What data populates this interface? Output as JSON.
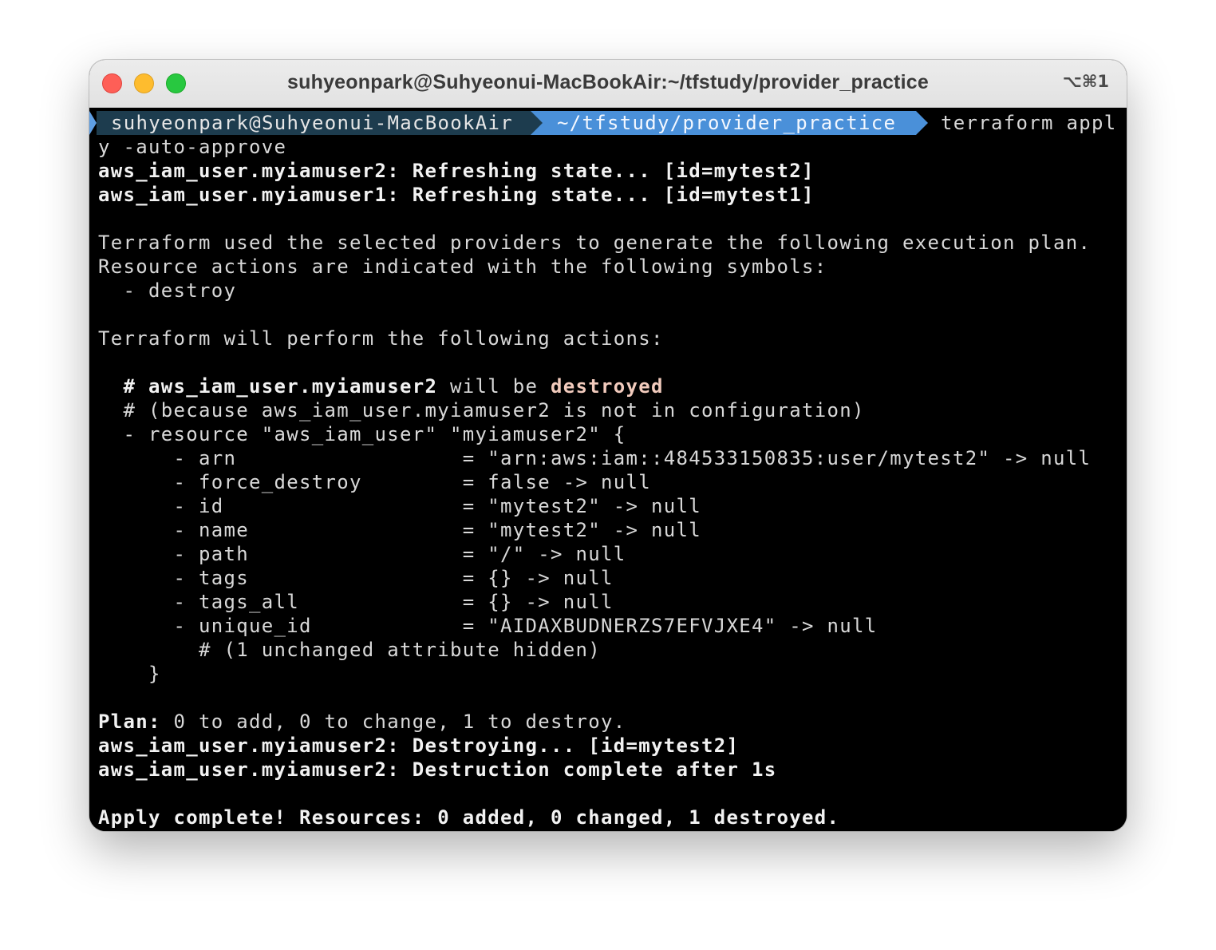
{
  "window": {
    "title": "suhyeonpark@Suhyeonui-MacBookAir:~/tfstudy/provider_practice",
    "shortcut": "⌥⌘1"
  },
  "prompt": {
    "user_host": "suhyeonpark@Suhyeonui-MacBookAir",
    "path": "~/tfstudy/provider_practice",
    "command_part1": "terraform appl",
    "command_part2": "y -auto-approve"
  },
  "output": {
    "refresh1": "aws_iam_user.myiamuser2: Refreshing state... [id=mytest2]",
    "refresh2": "aws_iam_user.myiamuser1: Refreshing state... [id=mytest1]",
    "plan_intro1": "Terraform used the selected providers to generate the following execution plan.",
    "plan_intro2": "Resource actions are indicated with the following symbols:",
    "symbol_destroy": "  - destroy",
    "perform": "Terraform will perform the following actions:",
    "resource_comment_hash": "  # ",
    "resource_comment_name": "aws_iam_user.myiamuser2",
    "resource_comment_mid": " will be ",
    "resource_comment_action": "destroyed",
    "because": "  # (because aws_iam_user.myiamuser2 is not in configuration)",
    "resource_open": "  - resource \"aws_iam_user\" \"myiamuser2\" {",
    "attributes": [
      "      - arn                  = \"arn:aws:iam::484533150835:user/mytest2\" -> null",
      "      - force_destroy        = false -> null",
      "      - id                   = \"mytest2\" -> null",
      "      - name                 = \"mytest2\" -> null",
      "      - path                 = \"/\" -> null",
      "      - tags                 = {} -> null",
      "      - tags_all             = {} -> null",
      "      - unique_id            = \"AIDAXBUDNERZS7EFVJXE4\" -> null"
    ],
    "hidden": "        # (1 unchanged attribute hidden)",
    "resource_close": "    }",
    "plan_label": "Plan:",
    "plan_summary": " 0 to add, 0 to change, 1 to destroy.",
    "destroying": "aws_iam_user.myiamuser2: Destroying... [id=mytest2]",
    "destroyed": "aws_iam_user.myiamuser2: Destruction complete after 1s",
    "apply_complete": "Apply complete! Resources: 0 added, 0 changed, 1 destroyed."
  }
}
